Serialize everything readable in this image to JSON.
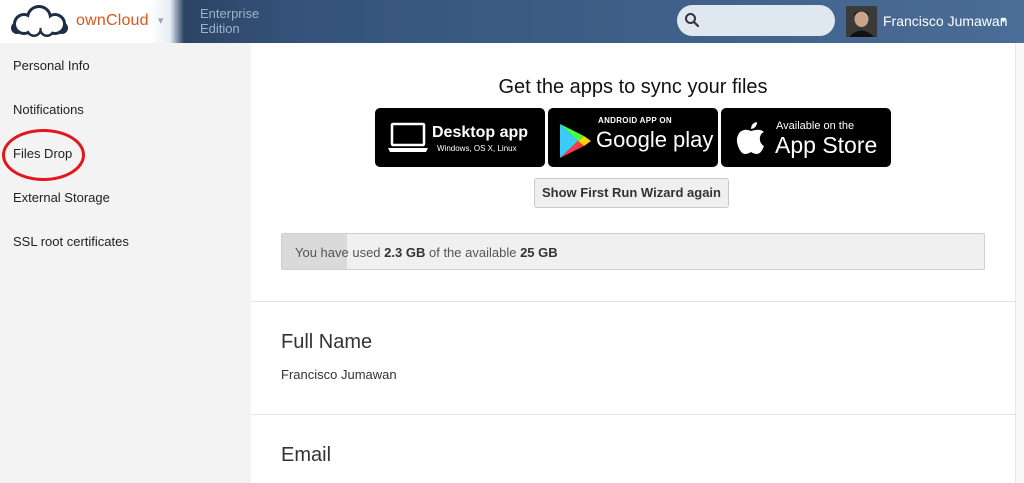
{
  "header": {
    "brand": "ownCloud",
    "brand_caret": "▾",
    "edition_line1": "Enterprise",
    "edition_line2": "Edition",
    "search_placeholder": "",
    "user_name": "Francisco Jumawan",
    "user_caret": "▾",
    "icons": [
      "owncloud-logo",
      "search-icon",
      "user-avatar",
      "caret-down"
    ]
  },
  "sidebar": {
    "items": [
      {
        "label": "Personal Info"
      },
      {
        "label": "Notifications"
      },
      {
        "label": "Files Drop"
      },
      {
        "label": "External Storage"
      },
      {
        "label": "SSL root certificates"
      }
    ],
    "highlight_color": "#e4161b"
  },
  "main": {
    "apps_title": "Get the apps to sync your files",
    "badges": {
      "desktop": {
        "title": "Desktop app",
        "subtitle": "Windows, OS X, Linux"
      },
      "google": {
        "top": "ANDROID APP ON",
        "title": "Google play"
      },
      "apple": {
        "top": "Available on the",
        "title": "App Store"
      }
    },
    "wizard_button": "Show First Run Wizard again",
    "quota": {
      "prefix": "You have used",
      "used": "2.3 GB",
      "middle": "of the available",
      "total": "25 GB",
      "used_fraction": 0.092
    },
    "full_name_title": "Full Name",
    "full_name_value": "Francisco Jumawan",
    "email_title": "Email"
  },
  "colors": {
    "brand_orange": "#d8571f",
    "header_dark": "#1d2d44",
    "header_light": "#4a6d97",
    "sidebar_bg": "#f3f3f3"
  }
}
